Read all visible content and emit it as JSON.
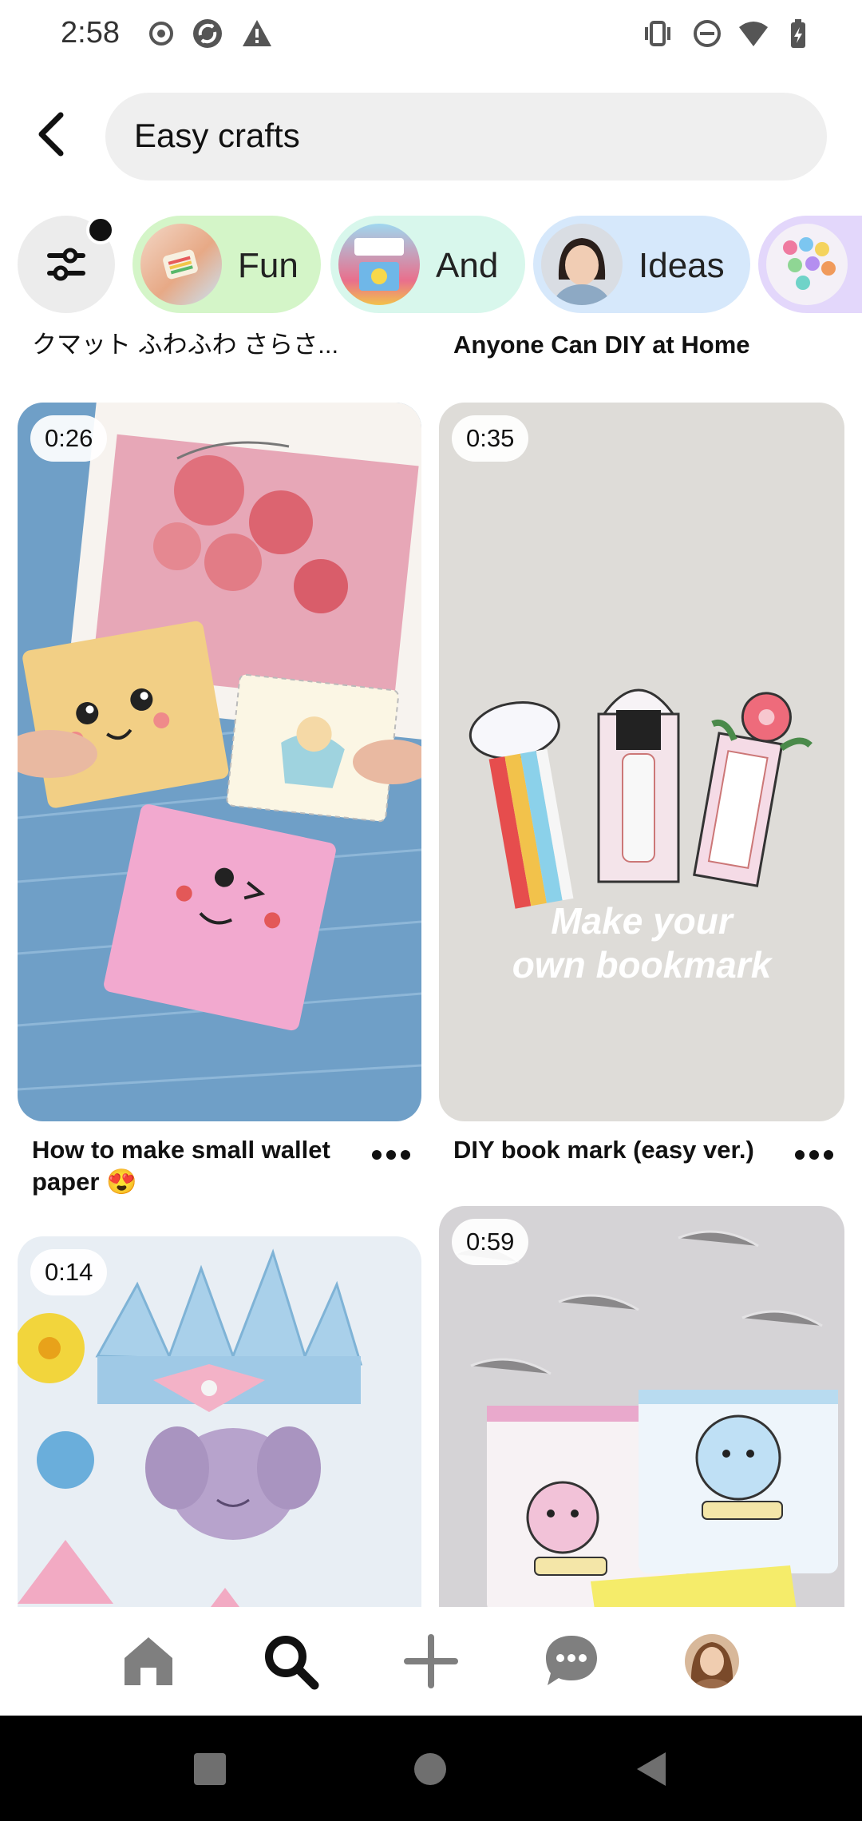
{
  "status_bar": {
    "time": "2:58",
    "left_icons": [
      "record-icon",
      "sync-icon",
      "warning-icon"
    ],
    "right_icons": [
      "vibrate-icon",
      "do-not-disturb-icon",
      "wifi-icon",
      "battery-icon"
    ]
  },
  "search": {
    "back_icon": "back-arrow-icon",
    "query": "Easy crafts"
  },
  "filters": {
    "filter_icon": "sliders-icon",
    "chips": [
      {
        "label": "Fun",
        "bg": "#d4f5c8"
      },
      {
        "label": "And",
        "bg": "#d8f7ec"
      },
      {
        "label": "Ideas",
        "bg": "#d6e8fb"
      },
      {
        "label": "",
        "bg": "#e3d7fb"
      }
    ]
  },
  "feed": {
    "top_captions": [
      "クマット ふわふわ さらさ...",
      "Anyone Can DIY at Home"
    ],
    "pins": [
      {
        "duration": "0:26",
        "title": "How to make small wallet paper 😍"
      },
      {
        "duration": "0:35",
        "title": "DIY book mark (easy ver.)",
        "overlay_line1": "Make your",
        "overlay_line2": "own bookmark"
      },
      {
        "duration": "0:14"
      },
      {
        "duration": "0:59"
      }
    ]
  },
  "bottom_nav": {
    "items": [
      "home-icon",
      "search-icon",
      "create-plus-icon",
      "messages-icon",
      "profile-avatar"
    ]
  },
  "system_nav": {
    "items": [
      "recents-square-icon",
      "home-circle-icon",
      "back-triangle-icon"
    ]
  },
  "colors": {
    "chip_fun": "#d4f5c8",
    "chip_and": "#d8f7ec",
    "chip_ideas": "#d6e8fb",
    "chip_extra": "#e3d7fb",
    "search_bg": "#efefef",
    "nav_icon": "#7f7f7f",
    "nav_active": "#111111"
  }
}
